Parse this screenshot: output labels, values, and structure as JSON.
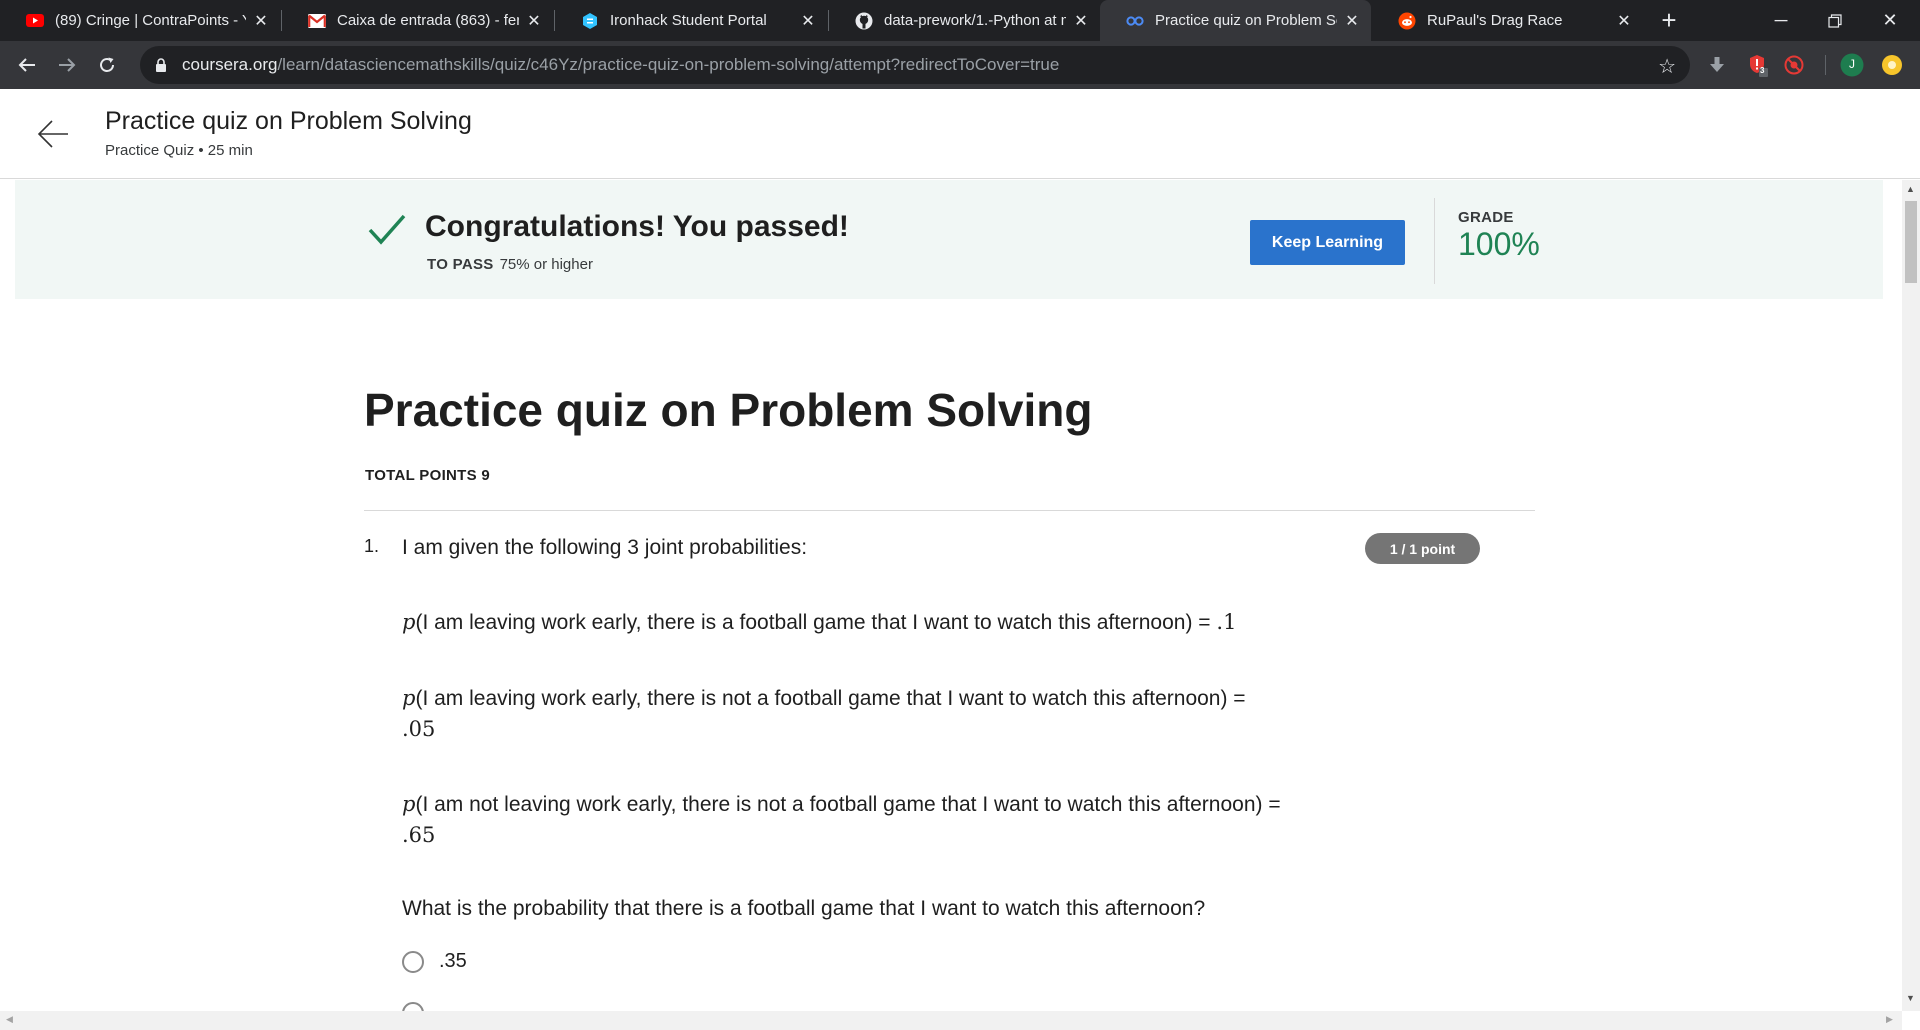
{
  "browser": {
    "tabs": [
      {
        "title": "(89) Cringe | ContraPoints - YouTube",
        "icon": "youtube-icon"
      },
      {
        "title": "Caixa de entrada (863) - fernanda",
        "icon": "gmail-icon"
      },
      {
        "title": "Ironhack Student Portal",
        "icon": "ironhack-icon"
      },
      {
        "title": "data-prework/1.-Python at master",
        "icon": "github-icon"
      },
      {
        "title": "Practice quiz on Problem Solving",
        "icon": "coursera-icon",
        "active": true
      },
      {
        "title": "RuPaul's Drag Race",
        "icon": "reddit-icon"
      }
    ],
    "url_host": "coursera.org",
    "url_path": "/learn/datasciencemathskills/quiz/c46Yz/practice-quiz-on-problem-solving/attempt?redirectToCover=true",
    "extension_badge": "3",
    "profile_initial": "J"
  },
  "header": {
    "title": "Practice quiz on Problem Solving",
    "subtitle": "Practice Quiz • 25 min"
  },
  "result": {
    "message": "Congratulations! You passed!",
    "to_pass_label": "TO PASS",
    "to_pass_value": "75% or higher",
    "button_label": "Keep Learning",
    "grade_label": "GRADE",
    "grade_value": "100%"
  },
  "quiz": {
    "title": "Practice quiz on Problem Solving",
    "total_points": "TOTAL POINTS 9",
    "question": {
      "number": "1.",
      "intro": "I am given the following 3 joint probabilities:",
      "points": "1 / 1 point",
      "p1_text": "(I am leaving work early, there is a football game that I want to watch this afternoon) = ",
      "p1_value": ".1",
      "p2_text": "(I am leaving work early, there is not a football game that I want to watch this afternoon) = ",
      "p2_value": ".05",
      "p3_text": "(I am not leaving work early, there is not a football game that I want to watch this afternoon) = ",
      "p3_value": ".65",
      "prob_symbol": "p",
      "prompt": "What is the probability that there is a football game that I want to watch this afternoon?",
      "options": [
        ".35"
      ]
    }
  },
  "colors": {
    "primary_button": "#2a73cc",
    "grade_green": "#1f8354",
    "pass_banner": "#f1f7f5",
    "points_badge": "#757575"
  }
}
